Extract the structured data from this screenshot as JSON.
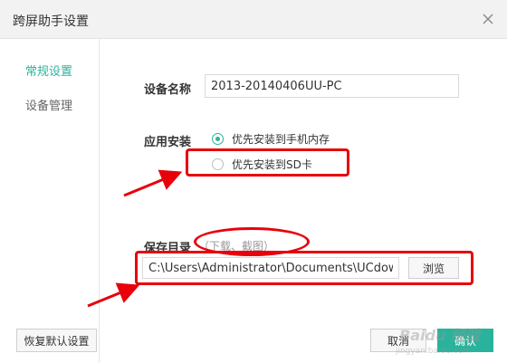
{
  "window": {
    "title": "跨屏助手设置"
  },
  "sidebar": {
    "items": [
      {
        "label": "常规设置",
        "active": true
      },
      {
        "label": "设备管理",
        "active": false
      }
    ]
  },
  "device": {
    "label": "设备名称",
    "value": "2013-20140406UU-PC"
  },
  "install": {
    "label": "应用安装",
    "options": [
      {
        "label": "优先安装到手机内存",
        "checked": true
      },
      {
        "label": "优先安装到SD卡",
        "checked": false
      }
    ]
  },
  "save": {
    "label": "保存目录",
    "hint": "（下载、截图）",
    "path": "C:\\Users\\Administrator\\Documents\\UCdownl",
    "browse_label": "浏览"
  },
  "footer": {
    "restore_label": "恢复默认设置",
    "cancel_label": "取消",
    "confirm_label": "确认"
  },
  "watermark": {
    "text": "Baidu 经验",
    "url": "jingyan.baidu.com"
  },
  "colors": {
    "accent": "#2ab39c",
    "annotation_red": "#e8000b"
  }
}
